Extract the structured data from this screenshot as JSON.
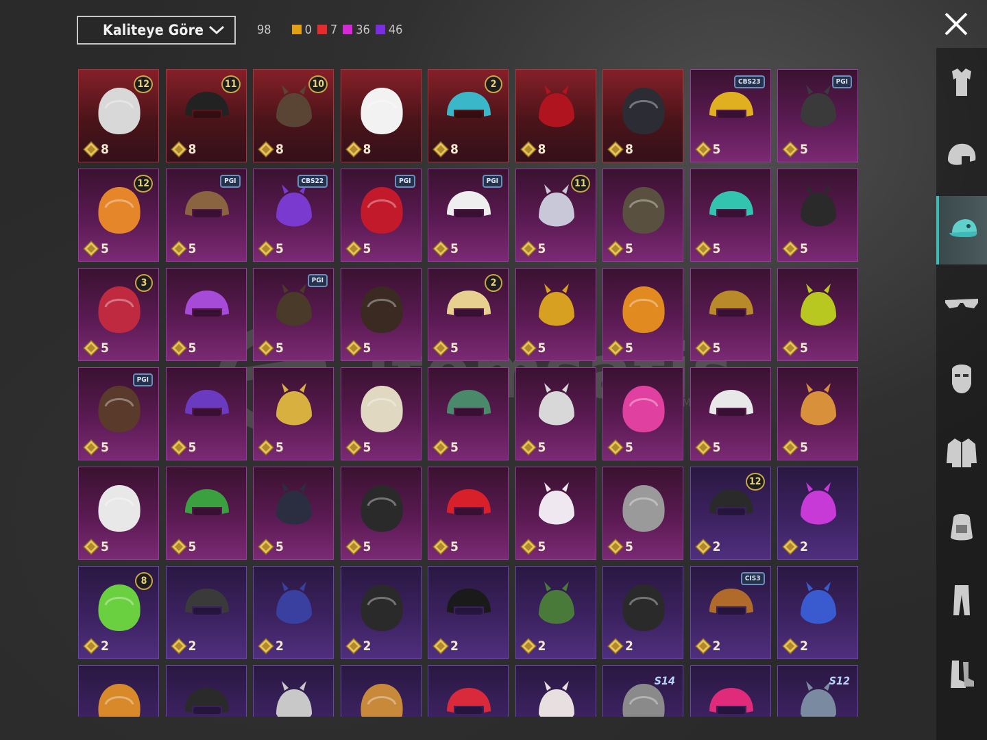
{
  "toolbar": {
    "sort_label": "Kaliteye Göre",
    "total_count": "98",
    "quality_counts": [
      {
        "color": "#e3a014",
        "count": "0"
      },
      {
        "color": "#e52b2b",
        "count": "7"
      },
      {
        "color": "#d62ad6",
        "count": "36"
      },
      {
        "color": "#7a2ee0",
        "count": "46"
      }
    ]
  },
  "watermark": {
    "brand": "itemsatis",
    "tagline": "HESAP / SKIN / İTEM / E-PIN .COM"
  },
  "sidebar": {
    "categories": [
      {
        "icon": "outfit-icon",
        "active": false
      },
      {
        "icon": "helmet-icon",
        "active": false
      },
      {
        "icon": "cap-icon",
        "active": true
      },
      {
        "icon": "glasses-icon",
        "active": false
      },
      {
        "icon": "mask-icon",
        "active": false
      },
      {
        "icon": "jacket-icon",
        "active": false
      },
      {
        "icon": "backpack-icon",
        "active": false
      },
      {
        "icon": "pants-icon",
        "active": false
      },
      {
        "icon": "boots-icon",
        "active": false
      }
    ]
  },
  "items": [
    {
      "tier": "red",
      "price": "8",
      "badge": "12",
      "color": "#d8d8d8"
    },
    {
      "tier": "red",
      "price": "8",
      "badge": "11",
      "color": "#222222"
    },
    {
      "tier": "red",
      "price": "8",
      "badge": "10",
      "color": "#5a4535"
    },
    {
      "tier": "red",
      "price": "8",
      "badge": "",
      "color": "#f2f2f2"
    },
    {
      "tier": "red",
      "price": "8",
      "badge": "2",
      "color": "#3ab7c8"
    },
    {
      "tier": "red",
      "price": "8",
      "badge": "",
      "color": "#b0141e"
    },
    {
      "tier": "red",
      "price": "8",
      "badge": "",
      "color": "#2c2c34"
    },
    {
      "tier": "purple",
      "price": "5",
      "badge": "CBS23",
      "color": "#e0b020"
    },
    {
      "tier": "purple",
      "price": "5",
      "badge": "PGI",
      "color": "#3a3a3a"
    },
    {
      "tier": "purple",
      "price": "5",
      "badge": "12",
      "color": "#e5862a"
    },
    {
      "tier": "purple",
      "price": "5",
      "badge": "PGI",
      "color": "#8a6440"
    },
    {
      "tier": "purple",
      "price": "5",
      "badge": "CBS22",
      "color": "#7a3ad0"
    },
    {
      "tier": "purple",
      "price": "5",
      "badge": "PGI",
      "color": "#c21a2a"
    },
    {
      "tier": "purple",
      "price": "5",
      "badge": "PGI",
      "color": "#eeeeee"
    },
    {
      "tier": "purple",
      "price": "5",
      "badge": "11",
      "color": "#c8c8d8"
    },
    {
      "tier": "purple",
      "price": "5",
      "badge": "",
      "color": "#5a5040"
    },
    {
      "tier": "purple",
      "price": "5",
      "badge": "",
      "color": "#33c4b0"
    },
    {
      "tier": "purple",
      "price": "5",
      "badge": "",
      "color": "#2a2a2a"
    },
    {
      "tier": "purple",
      "price": "5",
      "badge": "3",
      "color": "#c02a40"
    },
    {
      "tier": "purple",
      "price": "5",
      "badge": "",
      "color": "#a64ad8"
    },
    {
      "tier": "purple",
      "price": "5",
      "badge": "PGI",
      "color": "#4a3a2a"
    },
    {
      "tier": "purple",
      "price": "5",
      "badge": "",
      "color": "#3a2a22"
    },
    {
      "tier": "purple",
      "price": "5",
      "badge": "2",
      "color": "#e8d090"
    },
    {
      "tier": "purple",
      "price": "5",
      "badge": "",
      "color": "#d8a020"
    },
    {
      "tier": "purple",
      "price": "5",
      "badge": "",
      "color": "#e08a20"
    },
    {
      "tier": "purple",
      "price": "5",
      "badge": "",
      "color": "#b88a2a"
    },
    {
      "tier": "purple",
      "price": "5",
      "badge": "",
      "color": "#b8c820"
    },
    {
      "tier": "purple",
      "price": "5",
      "badge": "PGI",
      "color": "#5a3a2a"
    },
    {
      "tier": "purple",
      "price": "5",
      "badge": "",
      "color": "#6a3ac0"
    },
    {
      "tier": "purple",
      "price": "5",
      "badge": "",
      "color": "#d8b040"
    },
    {
      "tier": "purple",
      "price": "5",
      "badge": "",
      "color": "#e0d8c0"
    },
    {
      "tier": "purple",
      "price": "5",
      "badge": "",
      "color": "#4a8a6a"
    },
    {
      "tier": "purple",
      "price": "5",
      "badge": "",
      "color": "#d8d8d8"
    },
    {
      "tier": "purple",
      "price": "5",
      "badge": "",
      "color": "#e040a0"
    },
    {
      "tier": "purple",
      "price": "5",
      "badge": "",
      "color": "#e8e8e8"
    },
    {
      "tier": "purple",
      "price": "5",
      "badge": "",
      "color": "#d8903a"
    },
    {
      "tier": "purple",
      "price": "5",
      "badge": "",
      "color": "#e8e8e8"
    },
    {
      "tier": "purple",
      "price": "5",
      "badge": "",
      "color": "#3aa040"
    },
    {
      "tier": "purple",
      "price": "5",
      "badge": "",
      "color": "#2a2e40"
    },
    {
      "tier": "purple",
      "price": "5",
      "badge": "",
      "color": "#2a2a2a"
    },
    {
      "tier": "purple",
      "price": "5",
      "badge": "",
      "color": "#d8202a"
    },
    {
      "tier": "purple",
      "price": "5",
      "badge": "",
      "color": "#f0e8f0"
    },
    {
      "tier": "purple",
      "price": "5",
      "badge": "",
      "color": "#9a9a9a"
    },
    {
      "tier": "violet",
      "price": "2",
      "badge": "12",
      "color": "#2a2a2a"
    },
    {
      "tier": "violet",
      "price": "2",
      "badge": "",
      "color": "#c83ad8"
    },
    {
      "tier": "violet",
      "price": "2",
      "badge": "8",
      "color": "#6ad040"
    },
    {
      "tier": "violet",
      "price": "2",
      "badge": "",
      "color": "#3a3a3a"
    },
    {
      "tier": "violet",
      "price": "2",
      "badge": "",
      "color": "#3a40a0"
    },
    {
      "tier": "violet",
      "price": "2",
      "badge": "",
      "color": "#2a2a2a"
    },
    {
      "tier": "violet",
      "price": "2",
      "badge": "",
      "color": "#1a1a1a"
    },
    {
      "tier": "violet",
      "price": "2",
      "badge": "",
      "color": "#4a7a3a"
    },
    {
      "tier": "violet",
      "price": "2",
      "badge": "",
      "color": "#2a2a2a"
    },
    {
      "tier": "violet",
      "price": "2",
      "badge": "CIS3",
      "color": "#b06a2a"
    },
    {
      "tier": "violet",
      "price": "2",
      "badge": "",
      "color": "#3a5ad0"
    },
    {
      "tier": "violet",
      "price": "",
      "badge": "",
      "color": "#d88a2a"
    },
    {
      "tier": "violet",
      "price": "",
      "badge": "",
      "color": "#2a2a2a"
    },
    {
      "tier": "violet",
      "price": "",
      "badge": "",
      "color": "#c8c8c8"
    },
    {
      "tier": "violet",
      "price": "",
      "badge": "",
      "color": "#c88a3a"
    },
    {
      "tier": "violet",
      "price": "",
      "badge": "",
      "color": "#d82a3a"
    },
    {
      "tier": "violet",
      "price": "",
      "badge": "",
      "color": "#e8e0e0"
    },
    {
      "tier": "violet",
      "price": "",
      "badge": "S14",
      "color": "#8a8a8a"
    },
    {
      "tier": "violet",
      "price": "",
      "badge": "",
      "color": "#e02a7a"
    },
    {
      "tier": "violet",
      "price": "",
      "badge": "S12",
      "color": "#7a8aa0"
    }
  ]
}
